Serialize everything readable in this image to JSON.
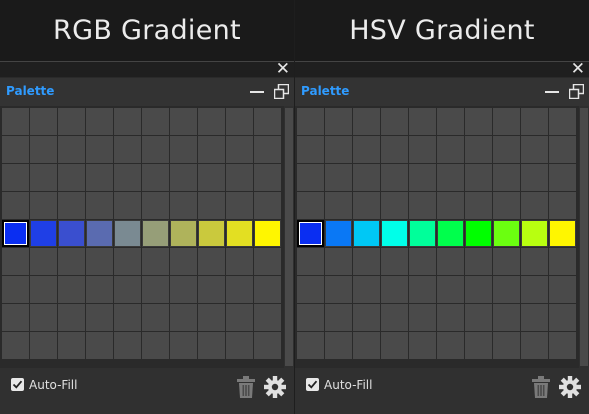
{
  "panels": [
    {
      "header": "RGB Gradient",
      "title": "Palette",
      "autofill_label": "Auto-Fill",
      "autofill_checked": true,
      "swatch_row": 4,
      "swatches": [
        "#0a2ef2",
        "#1f3fe6",
        "#3a4fcf",
        "#5a6bb0",
        "#7a8a92",
        "#969e78",
        "#afb35b",
        "#cac93d",
        "#e3df22",
        "#fff600"
      ]
    },
    {
      "header": "HSV Gradient",
      "title": "Palette",
      "autofill_label": "Auto-Fill",
      "autofill_checked": true,
      "swatch_row": 4,
      "swatches": [
        "#0a2ef2",
        "#0a78f5",
        "#00c8f5",
        "#00ffe9",
        "#00ff9a",
        "#00ff4c",
        "#00ff00",
        "#6bff10",
        "#b8ff10",
        "#fff600"
      ]
    }
  ],
  "icons": {
    "close": "close-icon",
    "minimize": "minimize-icon",
    "restore": "restore-icon",
    "trash": "trash-icon",
    "gear": "gear-icon"
  }
}
